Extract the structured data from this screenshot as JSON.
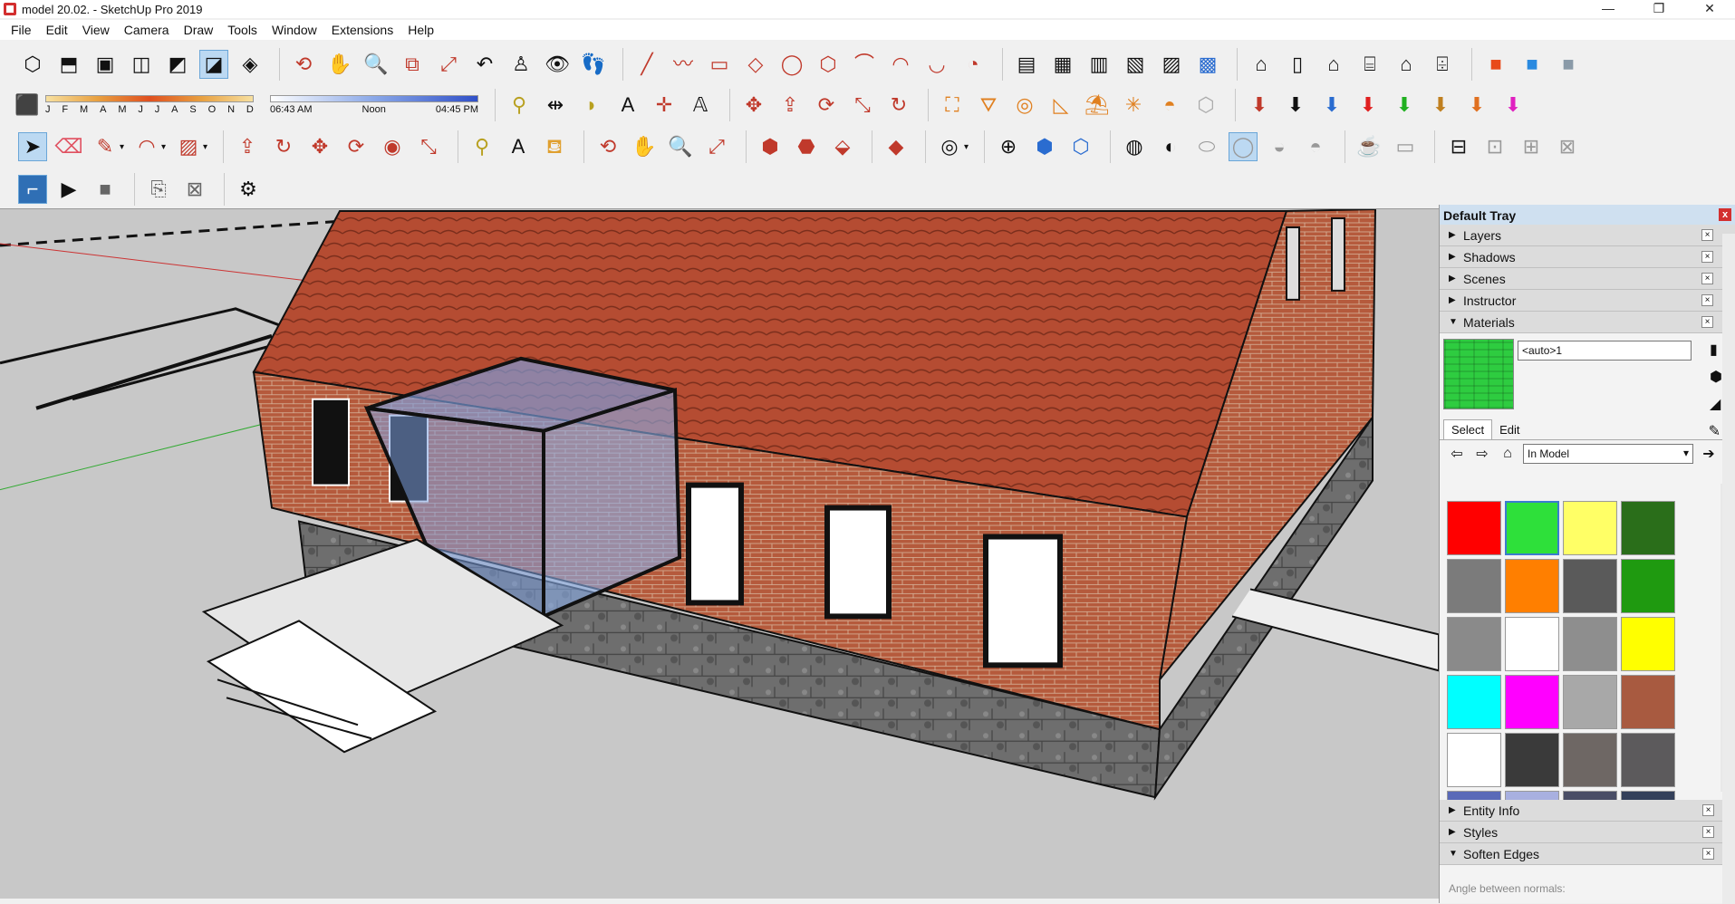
{
  "window": {
    "title": "model 20.02. - SketchUp Pro 2019",
    "minimize": "—",
    "maximize": "❐",
    "close": "✕"
  },
  "menu": [
    "File",
    "Edit",
    "View",
    "Camera",
    "Draw",
    "Tools",
    "Window",
    "Extensions",
    "Help"
  ],
  "shadow": {
    "months": [
      "J",
      "F",
      "M",
      "A",
      "M",
      "J",
      "J",
      "A",
      "S",
      "O",
      "N",
      "D"
    ],
    "time_start": "06:43 AM",
    "time_mid": "Noon",
    "time_end": "04:45 PM"
  },
  "tray": {
    "title": "Default Tray",
    "close": "x",
    "panels_top": [
      "Layers",
      "Shadows",
      "Scenes",
      "Instructor"
    ],
    "materials": {
      "label": "Materials",
      "name_value": "<auto>1",
      "tabs": [
        "Select",
        "Edit"
      ],
      "collection": "In Model",
      "swatches": [
        "#ff0000",
        "#2ee03a",
        "#ffff66",
        "#2a6e1a",
        "#7b7b7b",
        "#ff7f00",
        "#5a5a5a",
        "#1f9a10",
        "#8a8a8a",
        "#ffffff",
        "#8e8e8e",
        "#ffff00",
        "#00ffff",
        "#ff00ff",
        "#a8a8a8",
        "#a85a40",
        "#ffffff",
        "#3a3a3a",
        "#6e6764",
        "#5c5a5c",
        "#5a6ab8",
        "#a8b0e0",
        "#4a4e66",
        "#34405a"
      ]
    },
    "panels_bottom": [
      "Entity Info",
      "Styles",
      "Soften Edges"
    ],
    "soften_label": "Angle between normals:"
  },
  "accent": "#3b7bd0"
}
